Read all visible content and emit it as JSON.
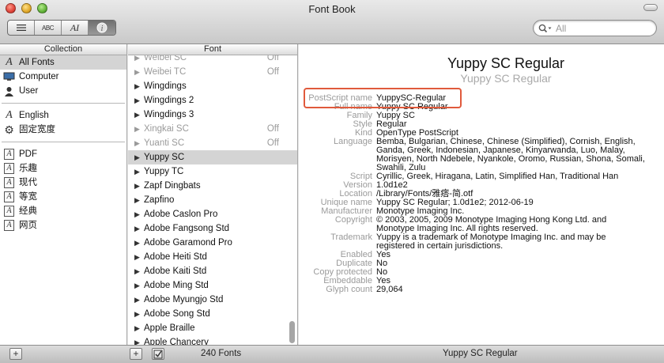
{
  "window": {
    "title": "Font Book"
  },
  "toolbar": {
    "view_buttons": [
      {
        "name": "list-view",
        "glyph": "☰"
      },
      {
        "name": "sample-view",
        "glyph": "ABC"
      },
      {
        "name": "repertoire-view",
        "glyph": "AI"
      },
      {
        "name": "info-view",
        "glyph": "ⓘ"
      }
    ],
    "search_placeholder": "All"
  },
  "collection": {
    "header": "Collection",
    "groups": [
      [
        {
          "label": "All Fonts",
          "icon": "font-a-icon",
          "selected": true
        },
        {
          "label": "Computer",
          "icon": "computer-icon"
        },
        {
          "label": "User",
          "icon": "user-icon"
        }
      ],
      [
        {
          "label": "English",
          "icon": "font-a-icon"
        },
        {
          "label": "固定宽度",
          "icon": "gear-icon"
        }
      ],
      [
        {
          "label": "PDF",
          "icon": "boxed-a-icon"
        },
        {
          "label": "乐趣",
          "icon": "boxed-a-icon"
        },
        {
          "label": "现代",
          "icon": "boxed-a-icon"
        },
        {
          "label": "等宽",
          "icon": "boxed-a-icon"
        },
        {
          "label": "经典",
          "icon": "boxed-a-icon"
        },
        {
          "label": "网页",
          "icon": "boxed-a-icon"
        }
      ]
    ]
  },
  "fonts": {
    "header": "Font",
    "items": [
      {
        "name": "Weibei SC",
        "off": true,
        "status": "Off"
      },
      {
        "name": "Weibei TC",
        "off": true,
        "status": "Off"
      },
      {
        "name": "Wingdings",
        "off": false,
        "status": ""
      },
      {
        "name": "Wingdings 2",
        "off": false,
        "status": ""
      },
      {
        "name": "Wingdings 3",
        "off": false,
        "status": ""
      },
      {
        "name": "Xingkai SC",
        "off": true,
        "status": "Off"
      },
      {
        "name": "Yuanti SC",
        "off": true,
        "status": "Off"
      },
      {
        "name": "Yuppy SC",
        "off": false,
        "status": "",
        "selected": true
      },
      {
        "name": "Yuppy TC",
        "off": false,
        "status": ""
      },
      {
        "name": "Zapf Dingbats",
        "off": false,
        "status": ""
      },
      {
        "name": "Zapfino",
        "off": false,
        "status": ""
      },
      {
        "name": "Adobe Caslon Pro",
        "off": false,
        "status": ""
      },
      {
        "name": "Adobe Fangsong Std",
        "off": false,
        "status": ""
      },
      {
        "name": "Adobe Garamond Pro",
        "off": false,
        "status": ""
      },
      {
        "name": "Adobe Heiti Std",
        "off": false,
        "status": ""
      },
      {
        "name": "Adobe Kaiti Std",
        "off": false,
        "status": ""
      },
      {
        "name": "Adobe Ming Std",
        "off": false,
        "status": ""
      },
      {
        "name": "Adobe Myungjo Std",
        "off": false,
        "status": ""
      },
      {
        "name": "Adobe Song Std",
        "off": false,
        "status": ""
      },
      {
        "name": "Apple Braille",
        "off": false,
        "status": ""
      },
      {
        "name": "Apple Chancery",
        "off": false,
        "status": ""
      }
    ]
  },
  "preview": {
    "title": "Yuppy SC Regular",
    "subtitle": "Yuppy SC Regular",
    "info": [
      {
        "label": "PostScript name",
        "value": "YuppySC-Regular"
      },
      {
        "label": "Full name",
        "value": "Yuppy SC Regular"
      },
      {
        "label": "Family",
        "value": "Yuppy SC"
      },
      {
        "label": "Style",
        "value": "Regular"
      },
      {
        "label": "Kind",
        "value": "OpenType PostScript"
      },
      {
        "label": "Language",
        "value": "Bemba, Bulgarian, Chinese, Chinese (Simplified), Cornish, English, Ganda, Greek, Indonesian, Japanese, Kinyarwanda, Luo, Malay, Morisyen, North Ndebele, Nyankole, Oromo, Russian, Shona, Somali, Swahili, Zulu"
      },
      {
        "label": "Script",
        "value": "Cyrillic, Greek, Hiragana, Latin, Simplified Han, Traditional Han"
      },
      {
        "label": "Version",
        "value": "1.0d1e2"
      },
      {
        "label": "Location",
        "value": "/Library/Fonts/雅痞-简.otf"
      },
      {
        "label": "Unique name",
        "value": "Yuppy SC Regular; 1.0d1e2; 2012-06-19"
      },
      {
        "label": "Manufacturer",
        "value": "Monotype Imaging Inc."
      },
      {
        "label": "Copyright",
        "value": "© 2003, 2005, 2009 Monotype Imaging Hong Kong Ltd. and Monotype Imaging Inc. All rights reserved."
      },
      {
        "label": "Trademark",
        "value": "Yuppy is a trademark of Monotype Imaging Inc. and may be registered in certain jurisdictions."
      },
      {
        "label": "Enabled",
        "value": "Yes"
      },
      {
        "label": "Duplicate",
        "value": "No"
      },
      {
        "label": "Copy protected",
        "value": "No"
      },
      {
        "label": "Embeddable",
        "value": "Yes"
      },
      {
        "label": "Glyph count",
        "value": "29,064"
      }
    ]
  },
  "bottombar": {
    "font_count": "240 Fonts",
    "selected_font": "Yuppy SC Regular"
  }
}
